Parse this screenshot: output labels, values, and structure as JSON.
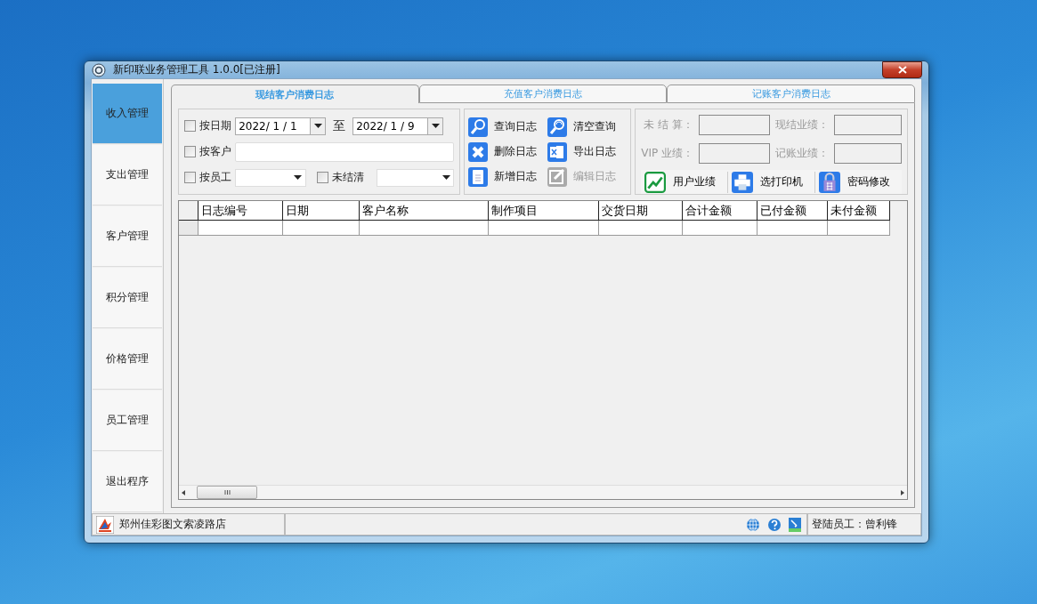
{
  "window": {
    "title": "新印联业务管理工具 1.0.0[已注册]"
  },
  "sidebar": {
    "items": [
      {
        "label": "收入管理",
        "selected": true
      },
      {
        "label": "支出管理",
        "selected": false
      },
      {
        "label": "客户管理",
        "selected": false
      },
      {
        "label": "积分管理",
        "selected": false
      },
      {
        "label": "价格管理",
        "selected": false
      },
      {
        "label": "员工管理",
        "selected": false
      },
      {
        "label": "退出程序",
        "selected": false
      }
    ]
  },
  "tabs": [
    {
      "label": "现结客户消费日志",
      "selected": true
    },
    {
      "label": "充值客户消费日志",
      "selected": false
    },
    {
      "label": "记账客户消费日志",
      "selected": false
    }
  ],
  "filters": {
    "date": {
      "label": "按日期",
      "checked": false,
      "from": "2022/ 1 / 1",
      "separator": "至",
      "to": "2022/ 1 / 9"
    },
    "customer": {
      "label": "按客户",
      "checked": false
    },
    "employee": {
      "label": "按员工",
      "checked": false
    },
    "unsettled": {
      "label": "未结清",
      "checked": false
    }
  },
  "actions": [
    {
      "label": "查询日志",
      "kind": "search",
      "disabled": false
    },
    {
      "label": "清空查询",
      "kind": "clear",
      "disabled": false
    },
    {
      "label": "删除日志",
      "kind": "delete",
      "disabled": false
    },
    {
      "label": "导出日志",
      "kind": "export",
      "disabled": false
    },
    {
      "label": "新增日志",
      "kind": "new",
      "disabled": false
    },
    {
      "label": "编辑日志",
      "kind": "edit",
      "disabled": true
    }
  ],
  "stats": [
    {
      "label": "未 结 算："
    },
    {
      "label": "现结业绩："
    },
    {
      "label": "VIP 业绩："
    },
    {
      "label": "记账业绩："
    }
  ],
  "tools": [
    {
      "label": "用户业绩",
      "kind": "chart"
    },
    {
      "label": "选打印机",
      "kind": "printer"
    },
    {
      "label": "密码修改",
      "kind": "lock"
    }
  ],
  "table": {
    "columns": [
      "日志编号",
      "日期",
      "客户名称",
      "制作项目",
      "交货日期",
      "合计金额",
      "已付金额",
      "未付金额"
    ]
  },
  "status_bar": {
    "shop": "郑州佳彩图文索凌路店",
    "employee": "登陆员工：曾利锋"
  }
}
